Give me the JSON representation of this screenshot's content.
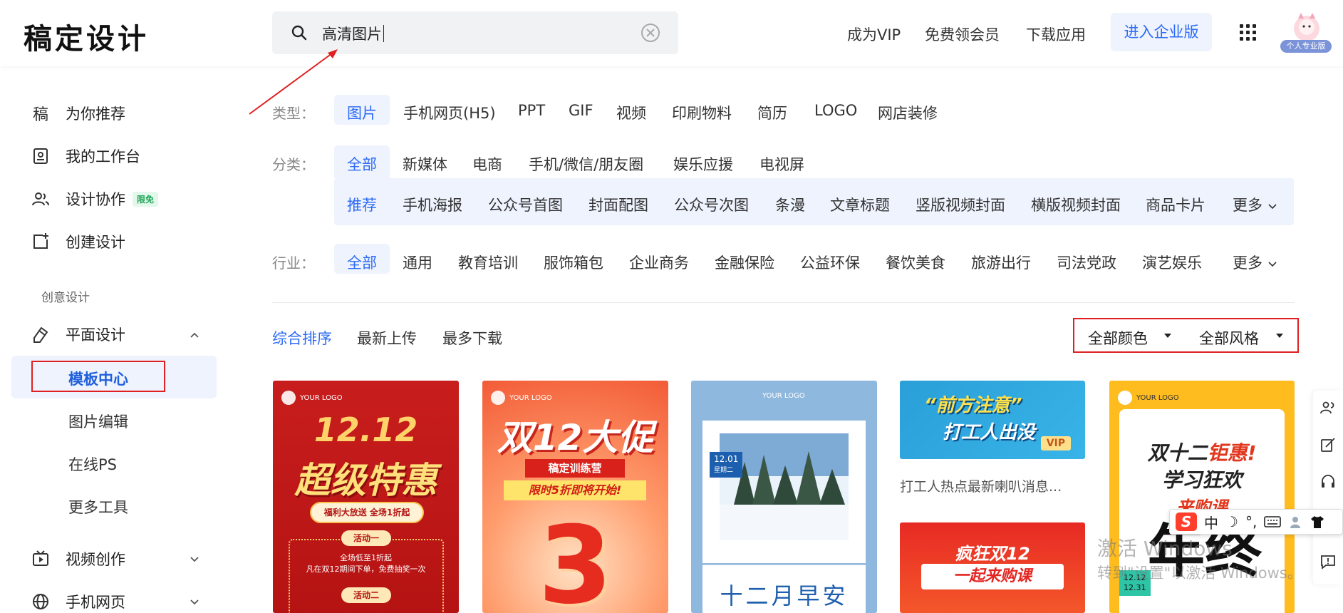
{
  "header": {
    "logo": "稿定设计",
    "search_value": "高清图片",
    "nav": [
      "成为VIP",
      "免费领会员",
      "下载应用"
    ],
    "enterprise": "进入企业版",
    "avatar_badge": "个人专业版"
  },
  "sidebar": {
    "items": [
      {
        "label": "为你推荐",
        "icon": "gao-logo-icon"
      },
      {
        "label": "我的工作台",
        "icon": "workspace-icon"
      },
      {
        "label": "设计协作",
        "icon": "users-icon",
        "badge": "限免"
      },
      {
        "label": "创建设计",
        "icon": "add-design-icon"
      }
    ],
    "section_title": "创意设计",
    "flat_design": "平面设计",
    "sub_items": [
      "模板中心",
      "图片编辑",
      "在线PS",
      "更多工具"
    ],
    "video": "视频创作",
    "mobile": "手机网页"
  },
  "filters": {
    "type_label": "类型：",
    "types": [
      "图片",
      "手机网页(H5)",
      "PPT",
      "GIF",
      "视频",
      "印刷物料",
      "简历",
      "LOGO",
      "网店装修"
    ],
    "category_label": "分类：",
    "categories": [
      "全部",
      "新媒体",
      "电商",
      "手机/微信/朋友圈",
      "娱乐应援",
      "电视屏"
    ],
    "subcategories": [
      "推荐",
      "手机海报",
      "公众号首图",
      "封面配图",
      "公众号次图",
      "条漫",
      "文章标题",
      "竖版视频封面",
      "横版视频封面",
      "商品卡片",
      "更多"
    ],
    "industry_label": "行业：",
    "industries": [
      "全部",
      "通用",
      "教育培训",
      "服饰箱包",
      "企业商务",
      "金融保险",
      "公益环保",
      "餐饮美食",
      "旅游出行",
      "司法党政",
      "演艺娱乐",
      "更多"
    ]
  },
  "sort": {
    "options": [
      "综合排序",
      "最新上传",
      "最多下载"
    ],
    "color": "全部颜色",
    "style": "全部风格"
  },
  "cards": {
    "c1": {
      "logo": "YOUR LOGO",
      "date": "12.12",
      "title": "超级特惠",
      "pill": "福利大放送 全场1折起",
      "tag1": "活动一",
      "text1": "全场低至1折起",
      "text2": "凡在双12期间下单，免费抽奖一次",
      "tag2": "活动二"
    },
    "c2": {
      "logo": "YOUR LOGO",
      "title": "双12大促",
      "banner1": "稿定训练营",
      "banner2": "限时5折即将开始!",
      "num": "3"
    },
    "c3": {
      "logo": "YOUR LOGO",
      "date": "12.01",
      "weekday": "星期二",
      "text": "十二月早安"
    },
    "c4": {
      "line1": "“前方注意”",
      "line2": "打工人出没",
      "vip": "VIP",
      "caption": "打工人热点最新喇叭消息..."
    },
    "c5": {
      "line1": "疯狂双12",
      "line2": "一起来购课"
    },
    "c6": {
      "logo": "YOUR LOGO",
      "l1a": "双十二",
      "l1b": "钜惠!",
      "l2": "学习狂欢",
      "l3": "来购课",
      "big": "年终",
      "date1": "12.12",
      "date2": "12.31"
    }
  },
  "overlay": {
    "ime": [
      "中",
      "☽",
      "°,"
    ],
    "watermark1": "激活 Windows",
    "watermark2": "转到\"设置\"以激活 Windows。"
  },
  "colors": {
    "accent": "#2d6bf5",
    "highlight_box": "#e02020"
  }
}
